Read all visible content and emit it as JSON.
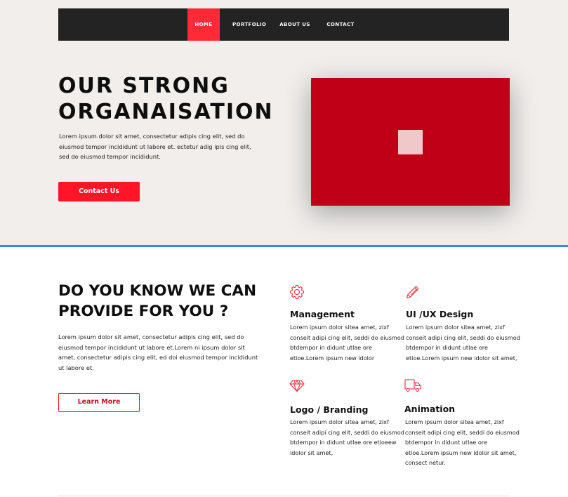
{
  "nav": {
    "items": [
      {
        "label": "HOME",
        "active": true
      },
      {
        "label": "PORTFOLIO",
        "active": false
      },
      {
        "label": "ABOUT US",
        "active": false
      },
      {
        "label": "CONTACT",
        "active": false
      }
    ]
  },
  "hero": {
    "title_line1": "OUR STRONG",
    "title_line2": "ORGANAISATION",
    "body": "Lorem ipsum dolor sit amet, consectetur adipis cing elit, sed do eiusmod tempor incididunt  ut labore et. ectetur adig ipis cing elit, sed do eiusmod tempor incididunt.",
    "cta_label": "Contact Us"
  },
  "services": {
    "title": "DO YOU KNOW WE CAN PROVIDE FOR YOU ?",
    "body": "Lorem ipsum dolor sit amet, consectetur adipis cing elit, sed do eiusmod tempor incididunt ut labore et.Lorem ni ipsum dolor sit amet, consectetur adipis cing elit, ed doi eiusmod tempor incididunt ut labore et.",
    "cta_label": "Learn More",
    "features": [
      {
        "icon": "gear-icon",
        "title": "Management",
        "text": "Lorem ipsum dolor sitea amet, zixf conseit  adipi cing elit, seddi do eiusmod btdempor in didunt utlae ore etioe.Lorem ipsum new idolor"
      },
      {
        "icon": "pencil-icon",
        "title": "UI /UX Design",
        "text": "Lorem ipsum dolor sitea amet, zixf conseit adipi cing elit, seddi do eiusmod btdempor in didunt utlae ore etioe.Lorem ipsum new idolor sit amet,"
      },
      {
        "icon": "diamond-icon",
        "title": "Logo / Branding",
        "text": "Lorem ipsum dolor sitea amet, zixf conseit  adipi cing elit, seddi do eiusmod btdempor in didunt utlae ore etioeew idolor sit amet,"
      },
      {
        "icon": "truck-icon",
        "title": "Animation",
        "text": "Lorem ipsum dolor sitea amet, zixf conseit adipi cing elit, seddi do eiusmod btdempor in didunt utlae ore etioe.Lorem ipsum new idolor sit amet, consect netur."
      }
    ]
  },
  "colors": {
    "accent": "#ff1428",
    "nav_bg": "#232323",
    "hero_bg": "#f1eeec",
    "media_red": "#bf0016",
    "divider_blue": "#2f8cf3"
  }
}
